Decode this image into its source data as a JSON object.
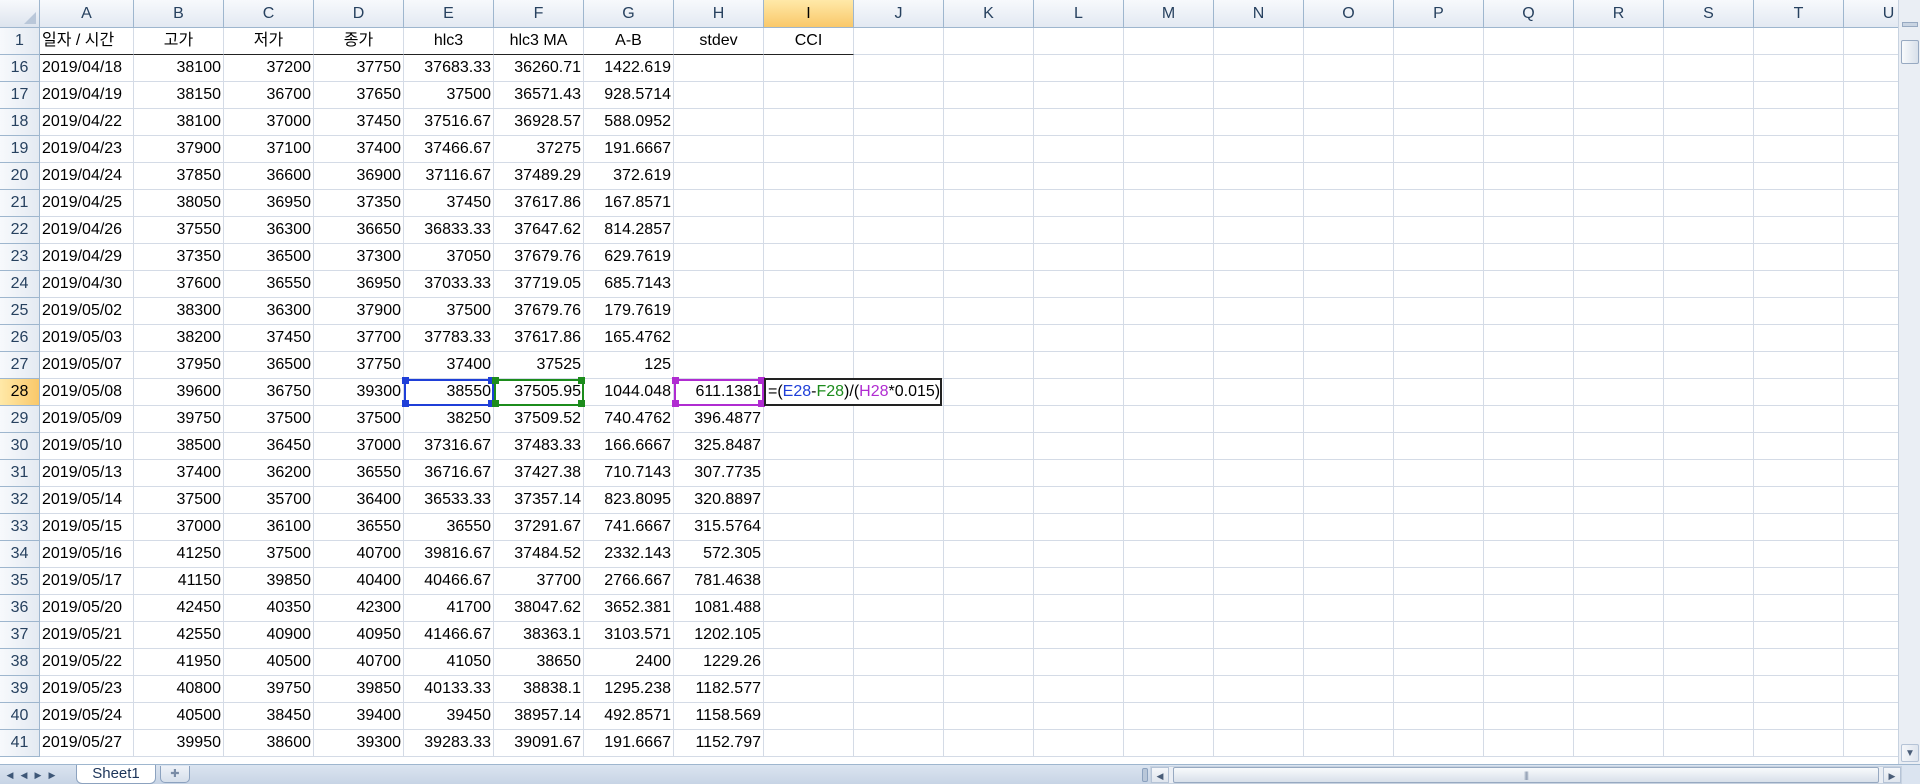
{
  "columns": [
    "A",
    "B",
    "C",
    "D",
    "E",
    "F",
    "G",
    "H",
    "I",
    "J",
    "K",
    "L",
    "M",
    "N",
    "O",
    "P",
    "Q",
    "R",
    "S",
    "T",
    "U"
  ],
  "header_row": {
    "number": "1",
    "cells": [
      "일자 / 시간",
      "고가",
      "저가",
      "종가",
      "hlc3",
      "hlc3 MA",
      "A-B",
      "stdev",
      "CCI"
    ]
  },
  "rows": [
    {
      "n": "16",
      "date": "2019/04/18",
      "high": "38100",
      "low": "37200",
      "close": "37750",
      "hlc3": "37683.33",
      "ma": "36260.71",
      "ab": "1422.619",
      "stdev": ""
    },
    {
      "n": "17",
      "date": "2019/04/19",
      "high": "38150",
      "low": "36700",
      "close": "37650",
      "hlc3": "37500",
      "ma": "36571.43",
      "ab": "928.5714",
      "stdev": ""
    },
    {
      "n": "18",
      "date": "2019/04/22",
      "high": "38100",
      "low": "37000",
      "close": "37450",
      "hlc3": "37516.67",
      "ma": "36928.57",
      "ab": "588.0952",
      "stdev": ""
    },
    {
      "n": "19",
      "date": "2019/04/23",
      "high": "37900",
      "low": "37100",
      "close": "37400",
      "hlc3": "37466.67",
      "ma": "37275",
      "ab": "191.6667",
      "stdev": ""
    },
    {
      "n": "20",
      "date": "2019/04/24",
      "high": "37850",
      "low": "36600",
      "close": "36900",
      "hlc3": "37116.67",
      "ma": "37489.29",
      "ab": "372.619",
      "stdev": ""
    },
    {
      "n": "21",
      "date": "2019/04/25",
      "high": "38050",
      "low": "36950",
      "close": "37350",
      "hlc3": "37450",
      "ma": "37617.86",
      "ab": "167.8571",
      "stdev": ""
    },
    {
      "n": "22",
      "date": "2019/04/26",
      "high": "37550",
      "low": "36300",
      "close": "36650",
      "hlc3": "36833.33",
      "ma": "37647.62",
      "ab": "814.2857",
      "stdev": ""
    },
    {
      "n": "23",
      "date": "2019/04/29",
      "high": "37350",
      "low": "36500",
      "close": "37300",
      "hlc3": "37050",
      "ma": "37679.76",
      "ab": "629.7619",
      "stdev": ""
    },
    {
      "n": "24",
      "date": "2019/04/30",
      "high": "37600",
      "low": "36550",
      "close": "36950",
      "hlc3": "37033.33",
      "ma": "37719.05",
      "ab": "685.7143",
      "stdev": ""
    },
    {
      "n": "25",
      "date": "2019/05/02",
      "high": "38300",
      "low": "36300",
      "close": "37900",
      "hlc3": "37500",
      "ma": "37679.76",
      "ab": "179.7619",
      "stdev": ""
    },
    {
      "n": "26",
      "date": "2019/05/03",
      "high": "38200",
      "low": "37450",
      "close": "37700",
      "hlc3": "37783.33",
      "ma": "37617.86",
      "ab": "165.4762",
      "stdev": ""
    },
    {
      "n": "27",
      "date": "2019/05/07",
      "high": "37950",
      "low": "36500",
      "close": "37750",
      "hlc3": "37400",
      "ma": "37525",
      "ab": "125",
      "stdev": ""
    },
    {
      "n": "28",
      "date": "2019/05/08",
      "high": "39600",
      "low": "36750",
      "close": "39300",
      "hlc3": "38550",
      "ma": "37505.95",
      "ab": "1044.048",
      "stdev": "611.1381"
    },
    {
      "n": "29",
      "date": "2019/05/09",
      "high": "39750",
      "low": "37500",
      "close": "37500",
      "hlc3": "38250",
      "ma": "37509.52",
      "ab": "740.4762",
      "stdev": "396.4877"
    },
    {
      "n": "30",
      "date": "2019/05/10",
      "high": "38500",
      "low": "36450",
      "close": "37000",
      "hlc3": "37316.67",
      "ma": "37483.33",
      "ab": "166.6667",
      "stdev": "325.8487"
    },
    {
      "n": "31",
      "date": "2019/05/13",
      "high": "37400",
      "low": "36200",
      "close": "36550",
      "hlc3": "36716.67",
      "ma": "37427.38",
      "ab": "710.7143",
      "stdev": "307.7735"
    },
    {
      "n": "32",
      "date": "2019/05/14",
      "high": "37500",
      "low": "35700",
      "close": "36400",
      "hlc3": "36533.33",
      "ma": "37357.14",
      "ab": "823.8095",
      "stdev": "320.8897"
    },
    {
      "n": "33",
      "date": "2019/05/15",
      "high": "37000",
      "low": "36100",
      "close": "36550",
      "hlc3": "36550",
      "ma": "37291.67",
      "ab": "741.6667",
      "stdev": "315.5764"
    },
    {
      "n": "34",
      "date": "2019/05/16",
      "high": "41250",
      "low": "37500",
      "close": "40700",
      "hlc3": "39816.67",
      "ma": "37484.52",
      "ab": "2332.143",
      "stdev": "572.305"
    },
    {
      "n": "35",
      "date": "2019/05/17",
      "high": "41150",
      "low": "39850",
      "close": "40400",
      "hlc3": "40466.67",
      "ma": "37700",
      "ab": "2766.667",
      "stdev": "781.4638"
    },
    {
      "n": "36",
      "date": "2019/05/20",
      "high": "42450",
      "low": "40350",
      "close": "42300",
      "hlc3": "41700",
      "ma": "38047.62",
      "ab": "3652.381",
      "stdev": "1081.488"
    },
    {
      "n": "37",
      "date": "2019/05/21",
      "high": "42550",
      "low": "40900",
      "close": "40950",
      "hlc3": "41466.67",
      "ma": "38363.1",
      "ab": "3103.571",
      "stdev": "1202.105"
    },
    {
      "n": "38",
      "date": "2019/05/22",
      "high": "41950",
      "low": "40500",
      "close": "40700",
      "hlc3": "41050",
      "ma": "38650",
      "ab": "2400",
      "stdev": "1229.26"
    },
    {
      "n": "39",
      "date": "2019/05/23",
      "high": "40800",
      "low": "39750",
      "close": "39850",
      "hlc3": "40133.33",
      "ma": "38838.1",
      "ab": "1295.238",
      "stdev": "1182.577"
    },
    {
      "n": "40",
      "date": "2019/05/24",
      "high": "40500",
      "low": "38450",
      "close": "39400",
      "hlc3": "39450",
      "ma": "38957.14",
      "ab": "492.8571",
      "stdev": "1158.569"
    },
    {
      "n": "41",
      "date": "2019/05/27",
      "high": "39950",
      "low": "38600",
      "close": "39300",
      "hlc3": "39283.33",
      "ma": "39091.67",
      "ab": "191.6667",
      "stdev": "1152.797"
    }
  ],
  "active": {
    "row": "28",
    "column": "I"
  },
  "formula": {
    "eq": "=(",
    "ref1": "E28",
    "minus": "-",
    "ref2": "F28",
    "mid": ")/(",
    "ref3": "H28",
    "tail": "*0.015)"
  },
  "sheet_tab": "Sheet1",
  "colors": {
    "ref1": "#1f3fd8",
    "ref2": "#1c8c1c",
    "ref3": "#b02cd1",
    "active_header": "#f9c86a"
  },
  "icons": {
    "nav": [
      "first-sheet-icon",
      "prev-sheet-icon",
      "next-sheet-icon",
      "last-sheet-icon"
    ],
    "new_sheet": "insert-sheet-icon"
  }
}
